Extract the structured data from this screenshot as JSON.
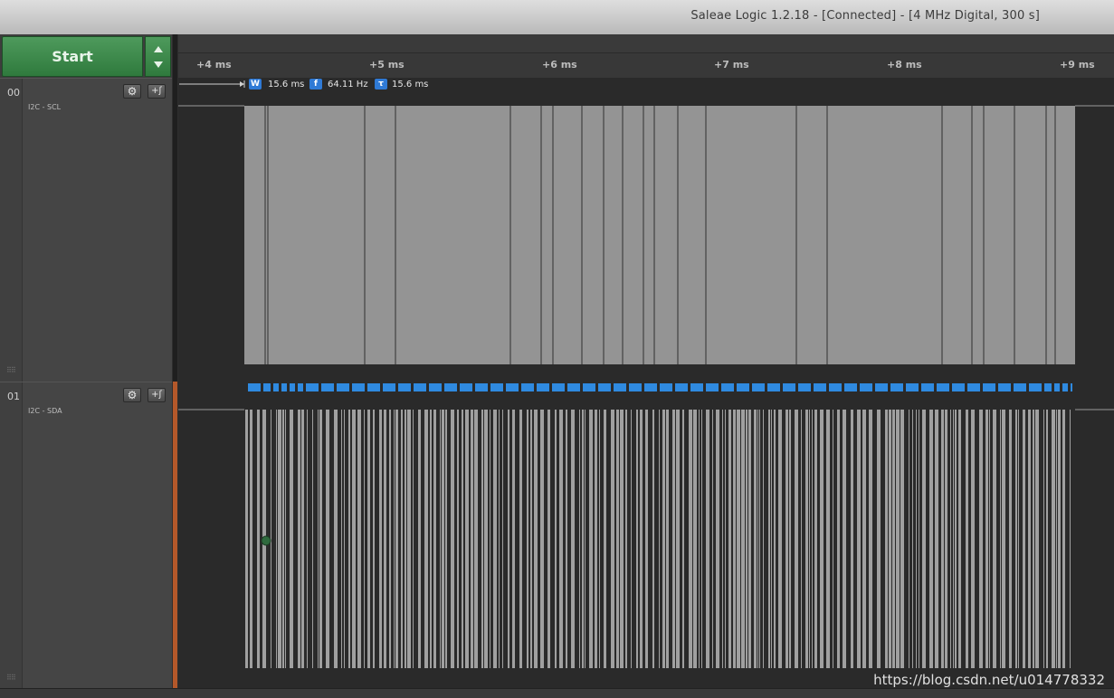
{
  "window": {
    "title": "Saleae Logic 1.2.18 - [Connected] - [4 MHz Digital, 300 s]"
  },
  "controls": {
    "start_label": "Start"
  },
  "timeline": {
    "ticks": [
      "+4 ms",
      "+5 ms",
      "+6 ms",
      "+7 ms",
      "+8 ms",
      "+9 ms"
    ]
  },
  "measurement": {
    "width_icon": "W",
    "width_value": "15.6 ms",
    "freq_icon": "f",
    "freq_value": "64.11 Hz",
    "period_icon": "τ",
    "period_value": "15.6 ms"
  },
  "channels": [
    {
      "number": "00",
      "name": "I2C - SCL",
      "settings_icon": "gear-icon",
      "trigger_icon": "trigger-icon"
    },
    {
      "number": "01",
      "name": "I2C - SDA",
      "settings_icon": "gear-icon",
      "trigger_icon": "trigger-icon"
    }
  ],
  "watermark": "https://blog.csdn.net/u014778332",
  "colors": {
    "signal": "#9a9a9a",
    "analyzer_bubble": "#2f8ae0",
    "start_button": "#3f8a4d",
    "channel_marker": "#b4582a"
  }
}
